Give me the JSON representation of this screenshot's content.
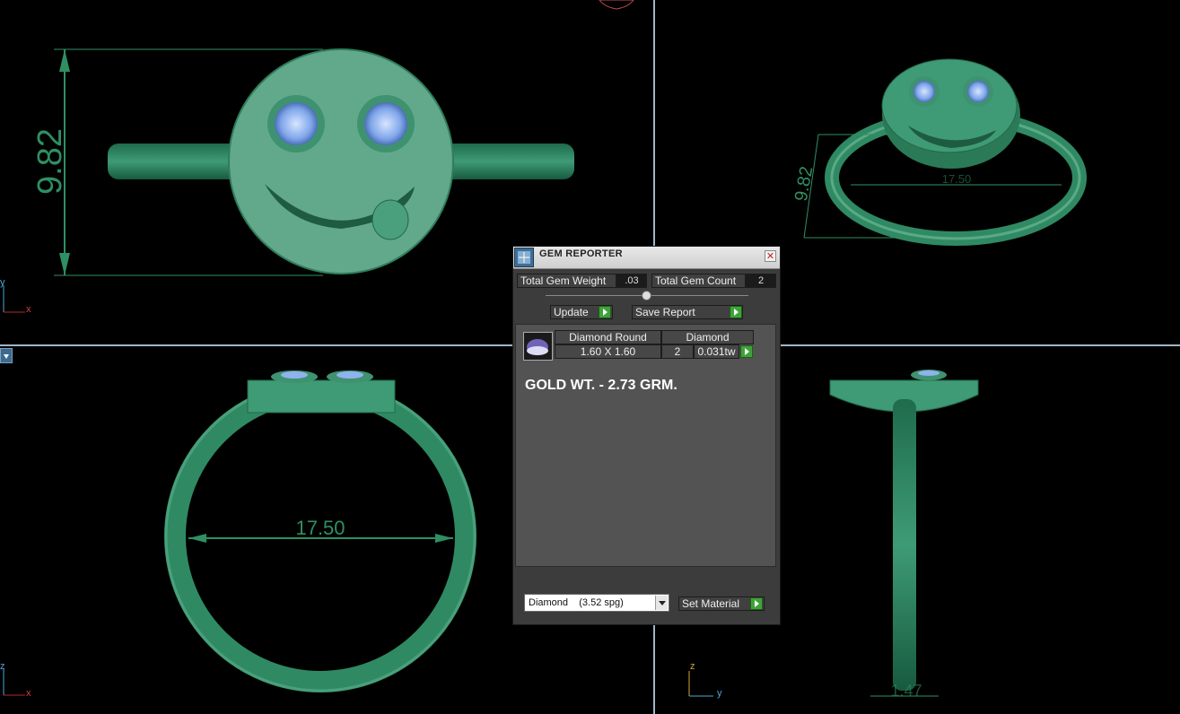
{
  "viewports": {
    "front_dimension": "9.82",
    "perspective_dimension": "9.82",
    "perspective_inner_dimension": "17.50",
    "top_dimension": "17.50",
    "side_dimension": "1.47"
  },
  "axes": {
    "front_vertical": "y",
    "front_horizontal": "x",
    "top_vertical": "z",
    "top_horizontal": "x",
    "side_vertical": "z",
    "side_horizontal": "y"
  },
  "dialog": {
    "title": "GEM REPORTER",
    "total_weight_label": "Total Gem Weight",
    "total_weight_value": ".03",
    "total_count_label": "Total Gem Count",
    "total_count_value": "2",
    "update_label": "Update",
    "save_report_label": "Save Report",
    "table": {
      "header_shape": "Diamond Round",
      "header_material": "Diamond",
      "size": "1.60 X 1.60",
      "count": "2",
      "weight": "0.031tw"
    },
    "gold_weight": "GOLD WT. - 2.73 GRM.",
    "material_select": "Diamond    (3.52 spg)",
    "set_material_label": "Set Material"
  },
  "colors": {
    "model": "#3e9b75",
    "background": "#000000",
    "divider": "#9fb6c8",
    "gem": "#8fb3ee"
  }
}
